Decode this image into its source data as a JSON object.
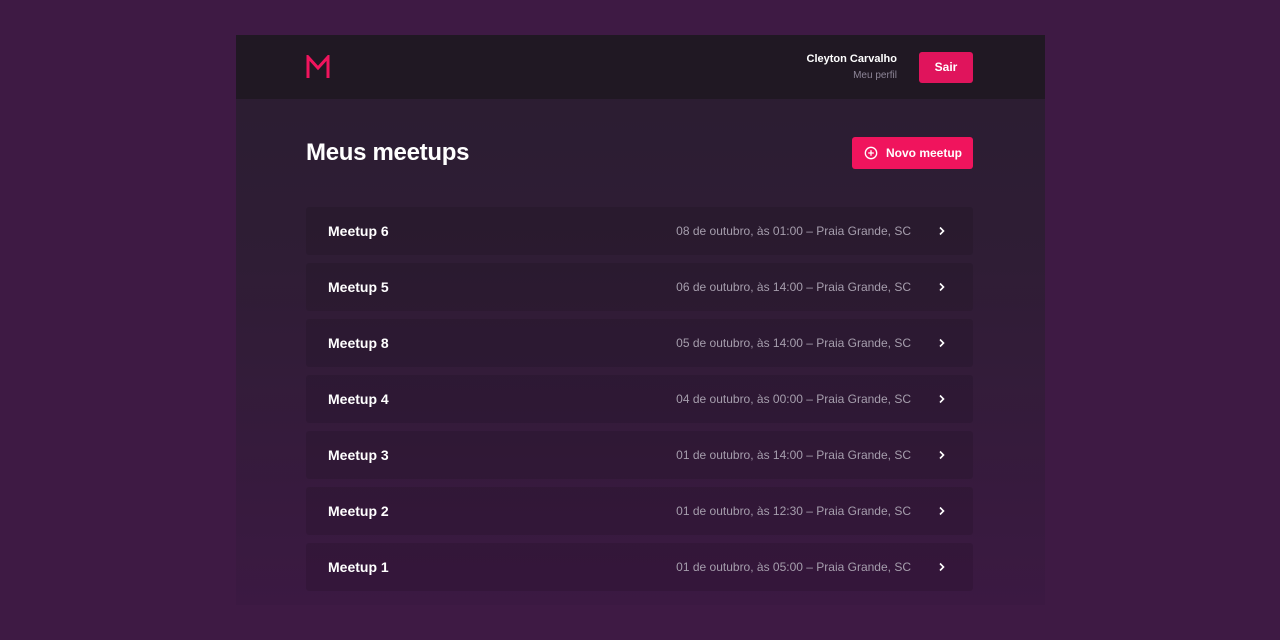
{
  "header": {
    "logo_icon": "meetapp-logo-m",
    "user_name": "Cleyton Carvalho",
    "profile_link": "Meu perfil",
    "logout_label": "Sair"
  },
  "main": {
    "title": "Meus meetups",
    "new_button_label": "Novo meetup",
    "new_button_icon": "add-circle-icon",
    "meetups": [
      {
        "title": "Meetup 6",
        "date": "08 de outubro, às 01:00 – Praia Grande, SC"
      },
      {
        "title": "Meetup 5",
        "date": "06 de outubro, às 14:00 – Praia Grande, SC"
      },
      {
        "title": "Meetup 8",
        "date": "05 de outubro, às 14:00 – Praia Grande, SC"
      },
      {
        "title": "Meetup 4",
        "date": "04 de outubro, às 00:00 – Praia Grande, SC"
      },
      {
        "title": "Meetup 3",
        "date": "01 de outubro, às 14:00 – Praia Grande, SC"
      },
      {
        "title": "Meetup 2",
        "date": "01 de outubro, às 12:30 – Praia Grande, SC"
      },
      {
        "title": "Meetup 1",
        "date": "01 de outubro, às 05:00 – Praia Grande, SC"
      }
    ]
  },
  "colors": {
    "background": "#3e1a44",
    "accent": "#f0145d",
    "header_bg": "#201823",
    "secondary_text": "#a69ead"
  }
}
